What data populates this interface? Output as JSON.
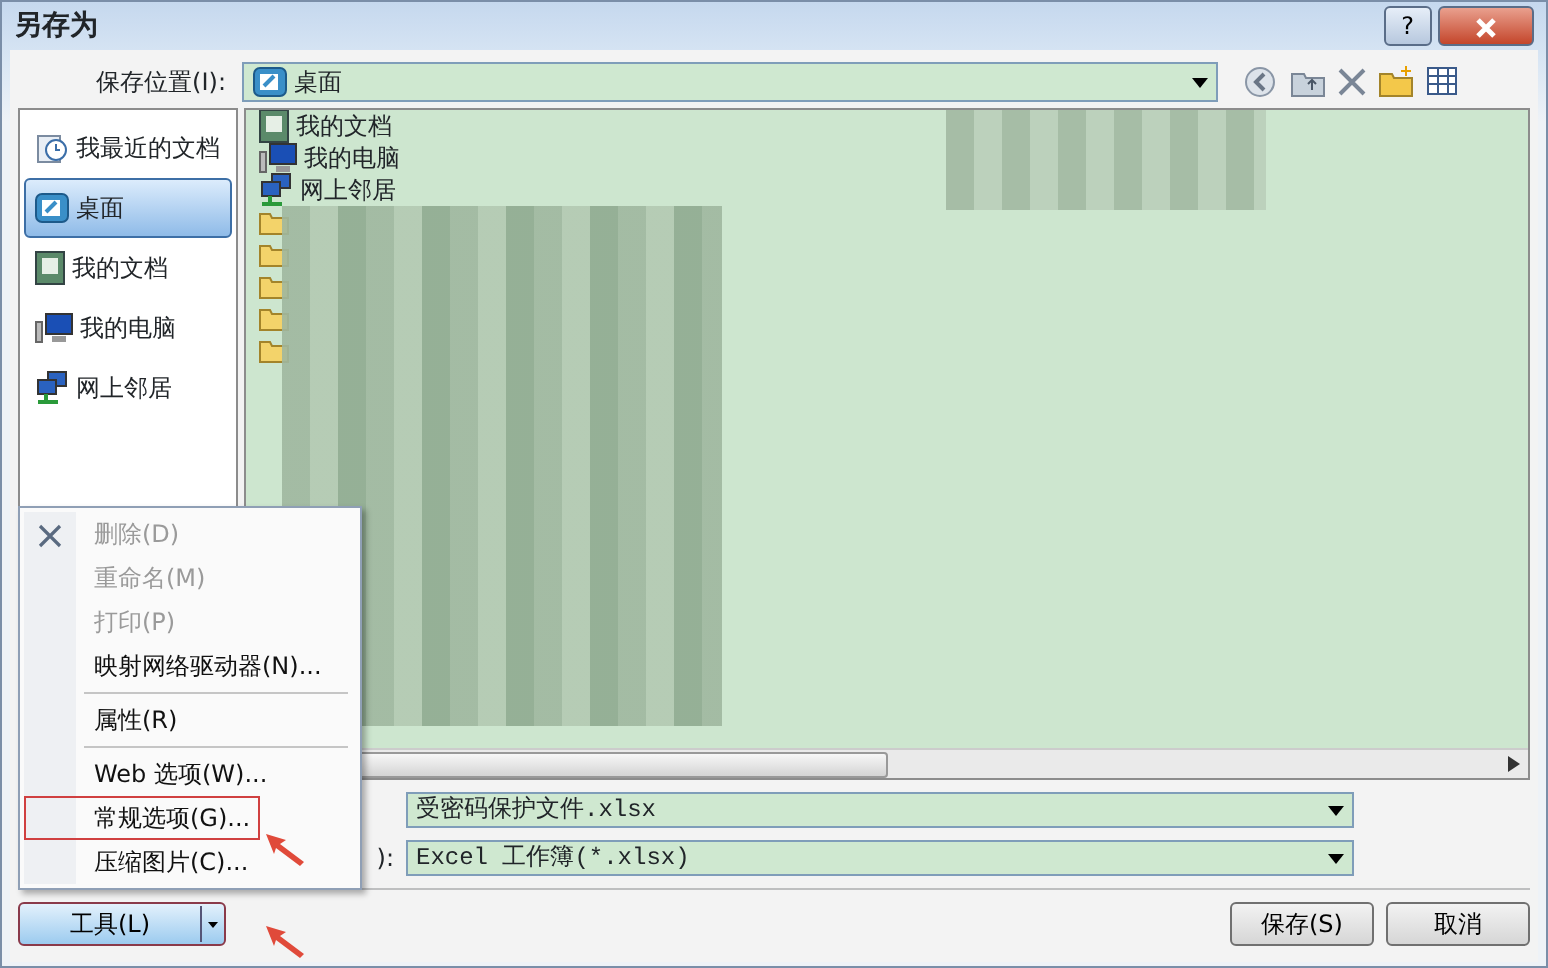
{
  "window": {
    "title": "另存为",
    "help": "?"
  },
  "save_in": {
    "label": "保存位置(I):",
    "value": "桌面"
  },
  "places": [
    {
      "label": "我最近的文档",
      "kind": "recent",
      "selected": false
    },
    {
      "label": "桌面",
      "kind": "desktop",
      "selected": true
    },
    {
      "label": "我的文档",
      "kind": "docs",
      "selected": false
    },
    {
      "label": "我的电脑",
      "kind": "computer",
      "selected": false
    },
    {
      "label": "网上邻居",
      "kind": "network",
      "selected": false
    }
  ],
  "files": [
    {
      "name": "我的文档",
      "kind": "docs"
    },
    {
      "name": "我的电脑",
      "kind": "computer"
    },
    {
      "name": "网上邻居",
      "kind": "network"
    },
    {
      "kind": "folder"
    },
    {
      "kind": "folder"
    },
    {
      "kind": "folder"
    },
    {
      "kind": "folder"
    },
    {
      "kind": "folder"
    }
  ],
  "menu": [
    {
      "label": "删除(D)",
      "disabled": true,
      "kind": "delete",
      "separator_after": false,
      "annotated": false
    },
    {
      "label": "重命名(M)",
      "disabled": true,
      "separator_after": false,
      "annotated": false
    },
    {
      "label": "打印(P)",
      "disabled": true,
      "separator_after": false,
      "annotated": false
    },
    {
      "label": "映射网络驱动器(N)...",
      "disabled": false,
      "separator_after": true,
      "annotated": false
    },
    {
      "label": "属性(R)",
      "disabled": false,
      "separator_after": true,
      "annotated": false
    },
    {
      "label": "Web 选项(W)...",
      "disabled": false,
      "separator_after": false,
      "annotated": false
    },
    {
      "label": "常规选项(G)...",
      "disabled": false,
      "separator_after": false,
      "annotated": true
    },
    {
      "label": "压缩图片(C)...",
      "disabled": false,
      "separator_after": false,
      "annotated": false
    }
  ],
  "file_name": {
    "value": "受密码保护文件.xlsx"
  },
  "file_type": {
    "label": "):",
    "value": "Excel 工作簿(*.xlsx)"
  },
  "buttons": {
    "tools": "工具(L)",
    "save": "保存(S)",
    "cancel": "取消"
  }
}
